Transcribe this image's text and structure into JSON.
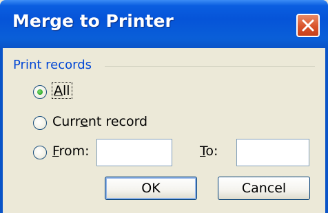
{
  "dialog": {
    "title": "Merge to Printer",
    "close_icon": "close-icon",
    "group": {
      "label": "Print records"
    },
    "options": {
      "all": {
        "prefix": "",
        "key": "A",
        "rest": "ll",
        "selected": true
      },
      "current": {
        "prefix": "Curr",
        "key": "e",
        "rest": "nt record",
        "selected": false
      },
      "from": {
        "prefix": "",
        "key": "F",
        "rest": "rom:",
        "selected": false
      }
    },
    "to_label": {
      "prefix": "",
      "key": "T",
      "rest": "o:"
    },
    "from_value": "",
    "to_value": "",
    "buttons": {
      "ok": "OK",
      "cancel": "Cancel"
    }
  },
  "colors": {
    "titlebar": "#0a54c8",
    "group_label": "#0046d5",
    "close_button": "#d9542c",
    "dialog_bg": "#ece9d8"
  }
}
